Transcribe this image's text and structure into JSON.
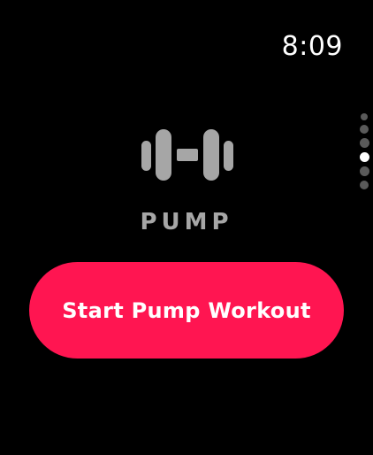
{
  "status_bar": {
    "time": "8:09"
  },
  "page_indicator": {
    "count": 6,
    "active_index": 3
  },
  "workout": {
    "icon": "dumbbell-icon",
    "title": "PUMP"
  },
  "start_button": {
    "label": "Start Pump Workout"
  },
  "colors": {
    "background": "#000000",
    "accent": "#ff1551",
    "icon": "#a6a6a6",
    "title": "#a6a6a6",
    "dot_inactive": "#5a5a5a",
    "dot_active": "#ffffff"
  }
}
